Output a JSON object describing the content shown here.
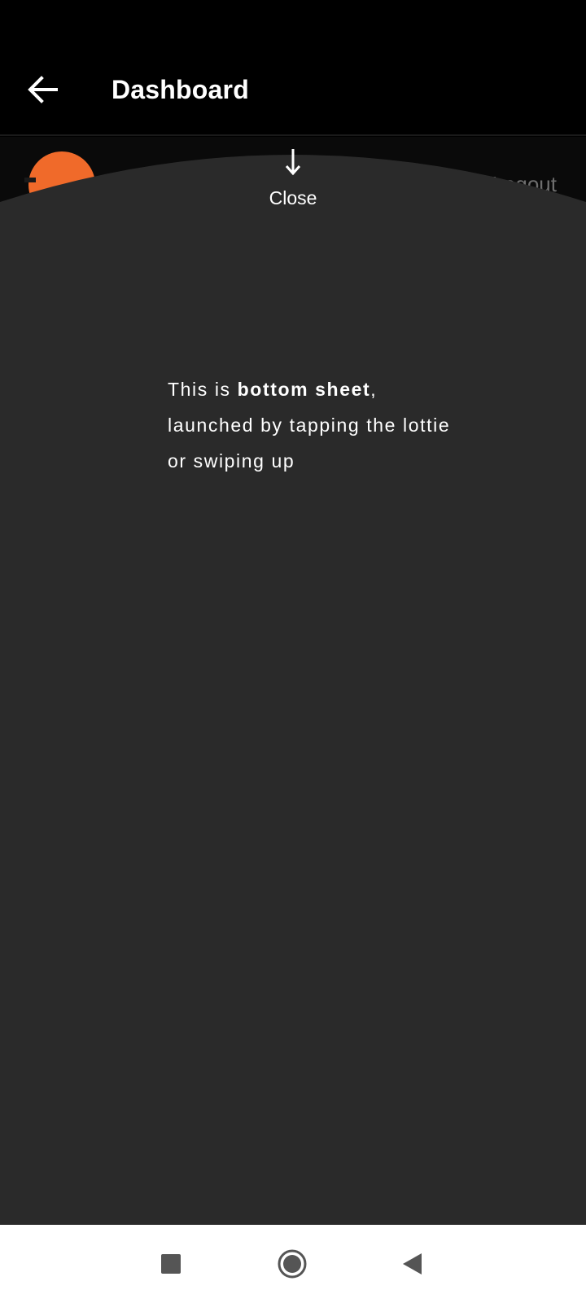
{
  "app_bar": {
    "title": "Dashboard",
    "back_icon": "arrow-back-icon"
  },
  "underlay": {
    "avatar_icon": "avatar-icon",
    "avatar_color": "#f06a2a",
    "logout_label": "Logout"
  },
  "bottom_sheet": {
    "close_icon": "arrow-down-icon",
    "close_label": "Close",
    "message_prefix": "This is ",
    "message_bold": "bottom sheet",
    "message_suffix": ", launched by tapping the lottie or swiping up",
    "background_color": "#2a2a2a"
  },
  "nav_bar": {
    "recents_icon": "square-icon",
    "home_icon": "circle-icon",
    "back_icon": "triangle-back-icon"
  }
}
